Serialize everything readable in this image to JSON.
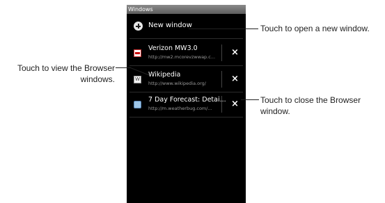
{
  "window_title": "Windows",
  "new_window": {
    "label": "New window",
    "icon": "plus-circle-icon"
  },
  "windows": [
    {
      "title": "Verizon MW3.0",
      "url": "http://mw2.mcorevzwwap.c...",
      "favicon": "verizon-favicon",
      "favicon_text": ""
    },
    {
      "title": "Wikipedia",
      "url": "http://www.wikipedia.org/",
      "favicon": "wikipedia-favicon",
      "favicon_text": "W"
    },
    {
      "title": "7 Day Forecast: Detai...",
      "url": "http://m.weatherbug.com/...",
      "favicon": "weatherbug-favicon",
      "favicon_text": ""
    }
  ],
  "close_symbol": "×",
  "callouts": {
    "open_new": "Touch to open a new window.",
    "view_line1": "Touch to view the Browser",
    "view_line2": "windows.",
    "close_line1": "Touch to close the Browser",
    "close_line2": "window."
  }
}
